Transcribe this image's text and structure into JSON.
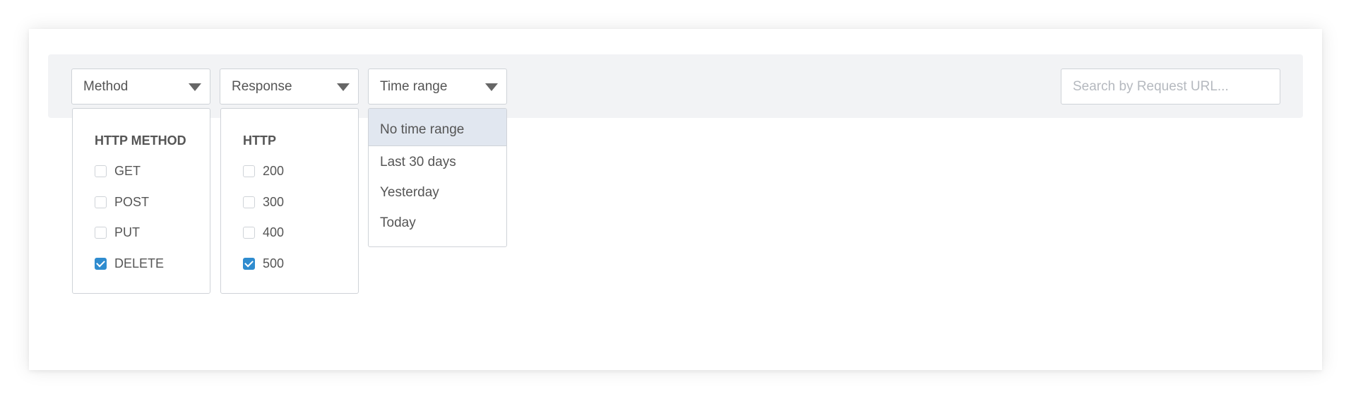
{
  "filters": {
    "method_label": "Method",
    "response_label": "Response",
    "time_label": "Time range"
  },
  "search": {
    "placeholder": "Search by Request URL..."
  },
  "method_panel": {
    "title": "HTTP METHOD",
    "options": [
      {
        "label": "GET",
        "checked": false
      },
      {
        "label": "POST",
        "checked": false
      },
      {
        "label": "PUT",
        "checked": false
      },
      {
        "label": "DELETE",
        "checked": true
      }
    ]
  },
  "response_panel": {
    "title": "HTTP",
    "options": [
      {
        "label": "200",
        "checked": false
      },
      {
        "label": "300",
        "checked": false
      },
      {
        "label": "400",
        "checked": false
      },
      {
        "label": "500",
        "checked": true
      }
    ]
  },
  "time_panel": {
    "items": [
      {
        "label": "No time range",
        "active": true
      },
      {
        "label": "Last 30 days",
        "active": false
      },
      {
        "label": "Yesterday",
        "active": false
      },
      {
        "label": "Today",
        "active": false
      }
    ]
  },
  "colors": {
    "accent": "#2f8ccf",
    "toolbar_bg": "#f2f3f5",
    "active_item_bg": "#e1e7f0"
  }
}
